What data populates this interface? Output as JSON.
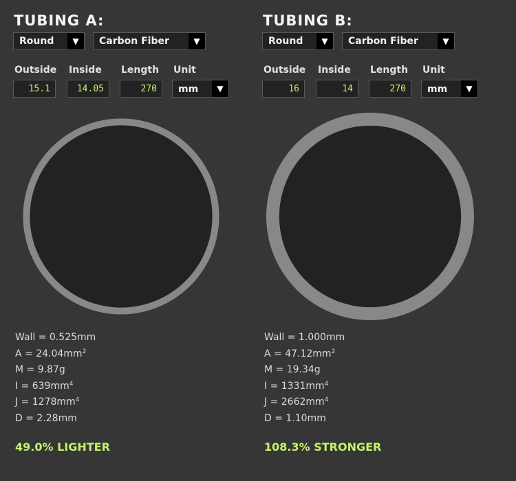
{
  "colors": {
    "background": "#363636",
    "field_background": "#222222",
    "accent_green": "#c6f26b",
    "tube_wall": "#888888",
    "tube_bore": "#222222"
  },
  "labels": {
    "outside": "Outside",
    "inside": "Inside",
    "length": "Length",
    "unit": "Unit"
  },
  "tubings": [
    {
      "title": "TUBING A:",
      "shape": "Round",
      "material": "Carbon Fiber",
      "outside": "15.1",
      "inside": "14.05",
      "length": "270",
      "unit": "mm",
      "outside_diameter": 15.1,
      "inside_diameter": 14.05,
      "stats": {
        "wall": "Wall = 0.525mm",
        "area": "A = 24.04mm",
        "area_sup": "2",
        "mass": "M = 9.87g",
        "inertia": "I = 639mm",
        "inertia_sup": "4",
        "polar": "J = 1278mm",
        "polar_sup": "4",
        "deflection": "D = 2.28mm"
      },
      "result": "49.0% LIGHTER"
    },
    {
      "title": "TUBING B:",
      "shape": "Round",
      "material": "Carbon Fiber",
      "outside": "16",
      "inside": "14",
      "length": "270",
      "unit": "mm",
      "outside_diameter": 16,
      "inside_diameter": 14,
      "stats": {
        "wall": "Wall = 1.000mm",
        "area": "A = 47.12mm",
        "area_sup": "2",
        "mass": "M = 19.34g",
        "inertia": "I = 1331mm",
        "inertia_sup": "4",
        "polar": "J = 2662mm",
        "polar_sup": "4",
        "deflection": "D = 1.10mm"
      },
      "result": "108.3% STRONGER"
    }
  ],
  "icons": {
    "dropdown": "▼"
  }
}
